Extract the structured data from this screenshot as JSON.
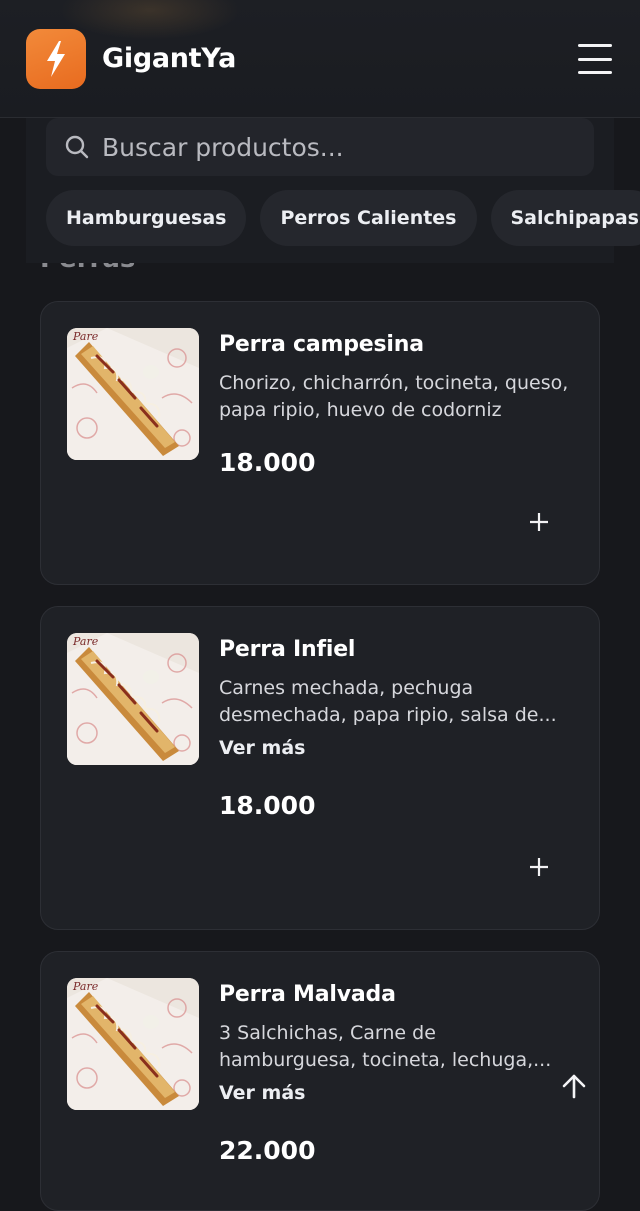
{
  "header": {
    "brand": "GigantYa",
    "logo_icon": "lightning-bolt-icon",
    "logo_color": "#ee7a2a",
    "menu_icon": "hamburger-menu-icon"
  },
  "search": {
    "placeholder": "Buscar productos...",
    "value": ""
  },
  "categories": [
    "Hamburguesas",
    "Perros Calientes",
    "Salchipapas"
  ],
  "section_title_partial": "Perras",
  "products": [
    {
      "name": "Perra campesina",
      "description": "Chorizo, chicharrón, tocineta, queso, papa ripio, huevo de codorniz",
      "more": "",
      "price": "18.000"
    },
    {
      "name": "Perra Infiel",
      "description": "Carnes mechada, pechuga desmechada, papa ripio, salsa de...",
      "more": "Ver más",
      "price": "18.000"
    },
    {
      "name": "Perra Malvada",
      "description": "3 Salchichas, Carne de hamburguesa, tocineta, lechuga,...",
      "more": "Ver más",
      "price": "22.000"
    }
  ],
  "add_icon": "plus-icon",
  "scroll_top_icon": "arrow-up-icon"
}
